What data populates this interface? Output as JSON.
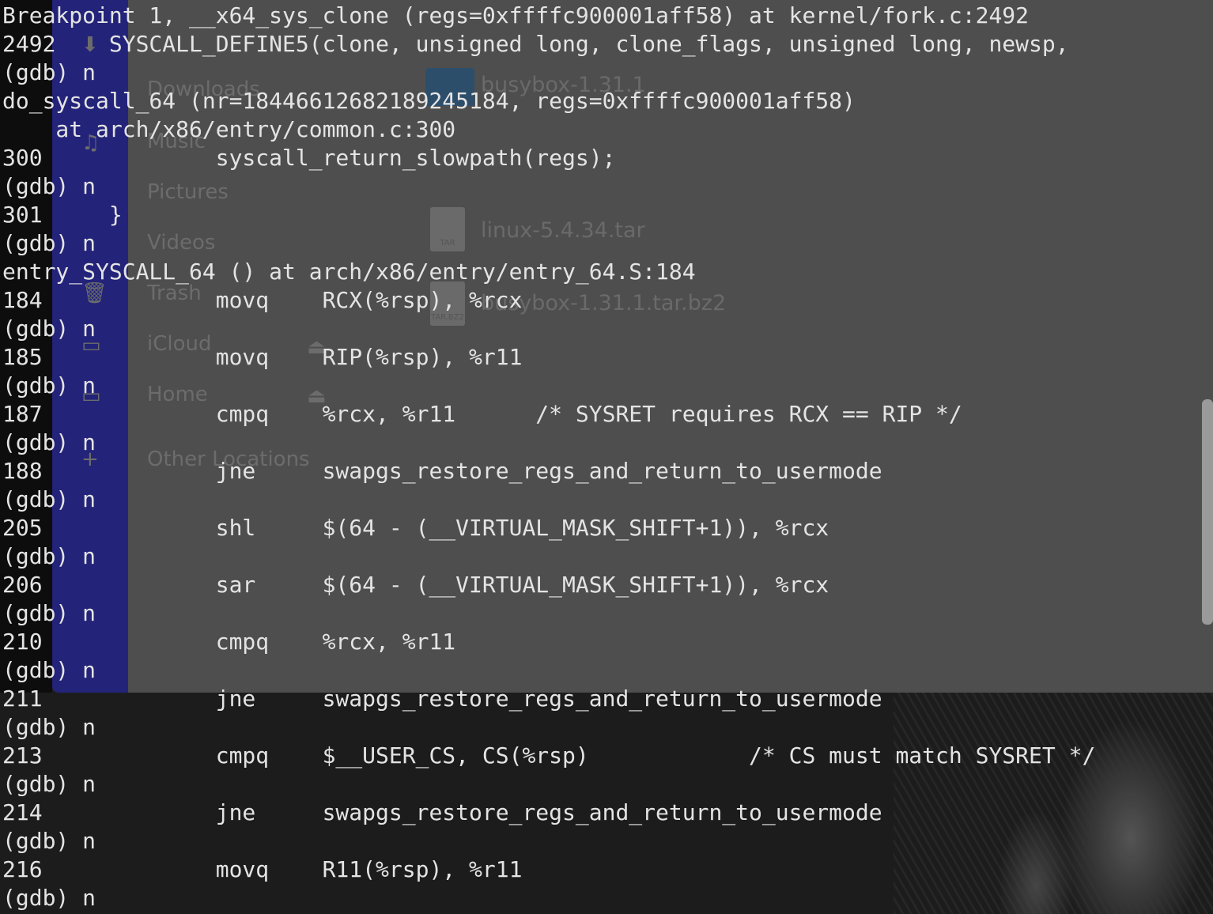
{
  "file_manager": {
    "sidebar_items": [
      {
        "label": "Downloads",
        "icon": "download-icon"
      },
      {
        "label": "Music",
        "icon": "music-icon"
      },
      {
        "label": "Pictures",
        "icon": "pictures-icon"
      },
      {
        "label": "Videos",
        "icon": "videos-icon"
      },
      {
        "label": "Trash",
        "icon": "trash-icon"
      },
      {
        "label": "iCloud",
        "icon": "drive-icon"
      },
      {
        "label": "Home",
        "icon": "drive-icon"
      },
      {
        "label": "Other Locations",
        "icon": "plus-icon"
      }
    ],
    "files": [
      {
        "name": "busybox-1.31.1",
        "icon": "folder-icon"
      },
      {
        "name": "linux-5.4.34.tar",
        "icon": "tar-icon",
        "badge": "TAR"
      },
      {
        "name": "busybox-1.31.1.tar.bz2",
        "icon": "bz2-icon",
        "badge": "TAR.BZ2"
      }
    ]
  },
  "terminal": {
    "lines": [
      "Breakpoint 1, __x64_sys_clone (regs=0xffffc900001aff58) at kernel/fork.c:2492",
      "2492\tSYSCALL_DEFINE5(clone, unsigned long, clone_flags, unsigned long, newsp,",
      "(gdb) n",
      "do_syscall_64 (nr=18446612682189245184, regs=0xffffc900001aff58)",
      "    at arch/x86/entry/common.c:300",
      "300\t\tsyscall_return_slowpath(regs);",
      "(gdb) n",
      "301\t}",
      "(gdb) n",
      "entry_SYSCALL_64 () at arch/x86/entry/entry_64.S:184",
      "184\t\tmovq\tRCX(%rsp), %rcx",
      "(gdb) n",
      "185\t\tmovq\tRIP(%rsp), %r11",
      "(gdb) n",
      "187\t\tcmpq\t%rcx, %r11\t/* SYSRET requires RCX == RIP */",
      "(gdb) n",
      "188\t\tjne\tswapgs_restore_regs_and_return_to_usermode",
      "(gdb) n",
      "205\t\tshl\t$(64 - (__VIRTUAL_MASK_SHIFT+1)), %rcx",
      "(gdb) n",
      "206\t\tsar\t$(64 - (__VIRTUAL_MASK_SHIFT+1)), %rcx",
      "(gdb) n",
      "210\t\tcmpq\t%rcx, %r11",
      "(gdb) n",
      "211\t\tjne\tswapgs_restore_regs_and_return_to_usermode",
      "(gdb) n",
      "213\t\tcmpq\t$__USER_CS, CS(%rsp)\t\t/* CS must match SYSRET */",
      "(gdb) n",
      "214\t\tjne\tswapgs_restore_regs_and_return_to_usermode",
      "(gdb) n",
      "216\t\tmovq\tR11(%rsp), %r11",
      "(gdb) n"
    ]
  }
}
